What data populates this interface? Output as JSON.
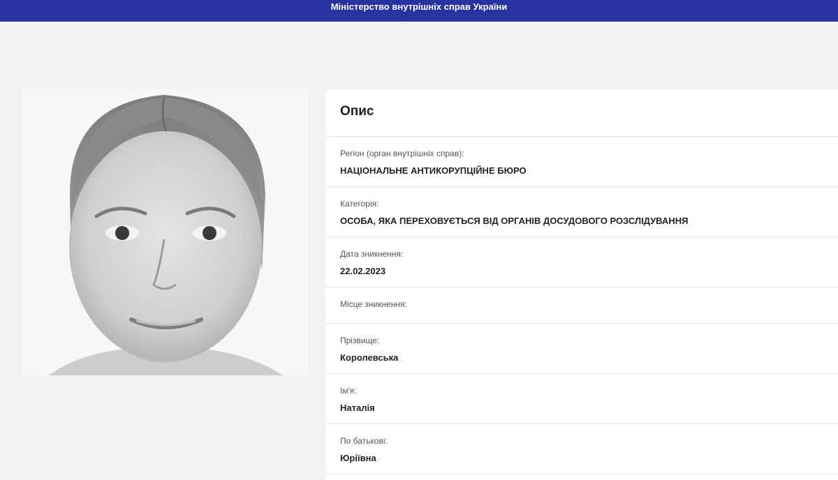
{
  "header": {
    "title": "Міністерство внутрішніх справ України"
  },
  "photo": {
    "icon": "person-photo"
  },
  "details": {
    "title": "Опис",
    "fields": [
      {
        "label": "Регіон (орган внутрішніх справ):",
        "value": "НАЦІОНАЛЬНЕ АНТИКОРУПЦІЙНЕ БЮРО"
      },
      {
        "label": "Категорія:",
        "value": "ОСОБА, ЯКА ПЕРЕХОВУЄТЬСЯ ВІД ОРГАНІВ ДОСУДОВОГО РОЗСЛІДУВАННЯ"
      },
      {
        "label": "Дата зникнення:",
        "value": "22.02.2023"
      },
      {
        "label": "Місце зникнення:",
        "value": ""
      },
      {
        "label": "Прізвище:",
        "value": "Королевська"
      },
      {
        "label": "Ім'я:",
        "value": "Наталія"
      },
      {
        "label": "По батькові:",
        "value": "Юріївна"
      }
    ]
  },
  "colors": {
    "header_bg": "#2633a0",
    "page_bg": "#f2f2f2",
    "card_bg": "#ffffff"
  }
}
